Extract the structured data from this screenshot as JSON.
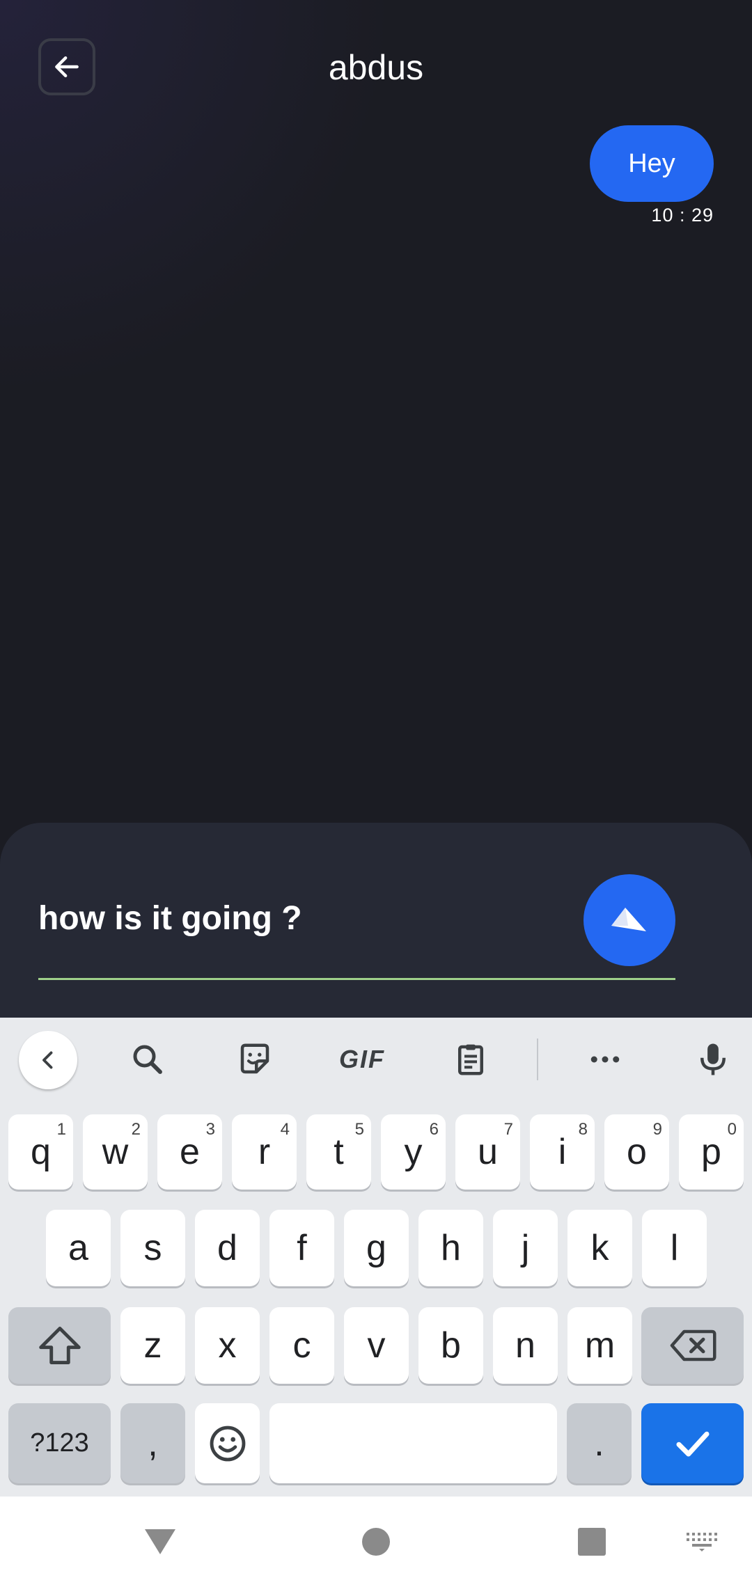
{
  "header": {
    "title": "abdus",
    "back_icon": "arrow-left-icon"
  },
  "messages": [
    {
      "text": "Hey",
      "time": "10 : 29",
      "direction": "outgoing",
      "color": "#2468f2"
    }
  ],
  "composer": {
    "value": "how is it going ?",
    "send_icon": "send-icon",
    "underline_color": "#9fd08a"
  },
  "keyboard": {
    "toolbar": [
      "chevron-left-icon",
      "search-icon",
      "sticker-icon",
      "GIF",
      "clipboard-icon",
      "more-icon",
      "mic-icon"
    ],
    "row1": [
      {
        "k": "q",
        "h": "1"
      },
      {
        "k": "w",
        "h": "2"
      },
      {
        "k": "e",
        "h": "3"
      },
      {
        "k": "r",
        "h": "4"
      },
      {
        "k": "t",
        "h": "5"
      },
      {
        "k": "y",
        "h": "6"
      },
      {
        "k": "u",
        "h": "7"
      },
      {
        "k": "i",
        "h": "8"
      },
      {
        "k": "o",
        "h": "9"
      },
      {
        "k": "p",
        "h": "0"
      }
    ],
    "row2": [
      "a",
      "s",
      "d",
      "f",
      "g",
      "h",
      "j",
      "k",
      "l"
    ],
    "row3": [
      "z",
      "x",
      "c",
      "v",
      "b",
      "n",
      "m"
    ],
    "symbols": "?123",
    "comma": ",",
    "period": ".",
    "accent": "#1a73e8"
  },
  "nav": [
    "back-triangle-icon",
    "home-circle-icon",
    "recents-square-icon",
    "keyboard-switch-icon"
  ]
}
